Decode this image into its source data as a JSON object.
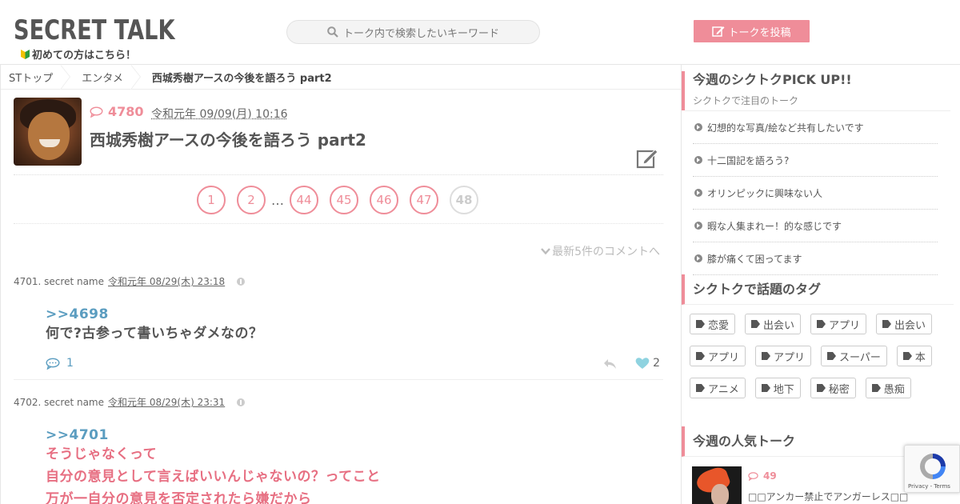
{
  "header": {
    "logo": "SECRET TALK",
    "beginner_link": "初めての方はこちら！",
    "search_placeholder": "トーク内で検索したいキーワード",
    "post_button": "トークを投稿"
  },
  "breadcrumb": [
    "STトップ",
    "エンタメ",
    "西城秀樹アースの今後を語ろう part2"
  ],
  "topic": {
    "comment_count": "4780",
    "date": "令和元年 09/09(月) 10:16",
    "title": "西城秀樹アースの今後を語ろう part2"
  },
  "pager": {
    "pages": [
      "1",
      "2",
      "44",
      "45",
      "46",
      "47",
      "48"
    ],
    "ellipsis": "…",
    "current": "48"
  },
  "latest_link": "最新5件のコメントへ",
  "comments": [
    {
      "meta": "4701. secret name",
      "date": "令和元年 08/29(木) 23:18",
      "anchor": ">>4698",
      "lines": [
        "何で?古参って書いちゃダメなの？"
      ],
      "reply_count": "1",
      "likes": "2"
    },
    {
      "meta": "4702. secret name",
      "date": "令和元年 08/29(木) 23:31",
      "anchor": ">>4701",
      "lines": [
        "そうじゃなくって",
        "自分の意見として言えばいいんじゃないの？ってこと",
        "万が一自分の意見を否定されたら嫌だから"
      ]
    }
  ],
  "sidebar": {
    "pickup": {
      "title": "今週のシクトクPICK UP!!",
      "subtitle": "シクトクで注目のトーク",
      "items": [
        "幻想的な写真/絵など共有したいです",
        "十二国記を語ろう?",
        "オリンピックに興味ない人",
        "暇な人集まれー！的な感じです",
        "膝が痛くて困ってます"
      ]
    },
    "tags": {
      "title": "シクトクで話題のタグ",
      "items": [
        "恋愛",
        "出会い",
        "アプリ",
        "出会い",
        "アプリ",
        "アプリ",
        "スーパー",
        "本",
        "アニメ",
        "地下",
        "秘密",
        "愚痴"
      ]
    },
    "popular": {
      "title": "今週の人気トーク",
      "count": "49",
      "item_title": "□□アンカー禁止でアンガーレス□□"
    }
  },
  "recaptcha": "Privacy - Terms",
  "colors": {
    "accent": "#ef8d99",
    "link": "#5b9dc0",
    "pink_text": "#e76f82"
  }
}
